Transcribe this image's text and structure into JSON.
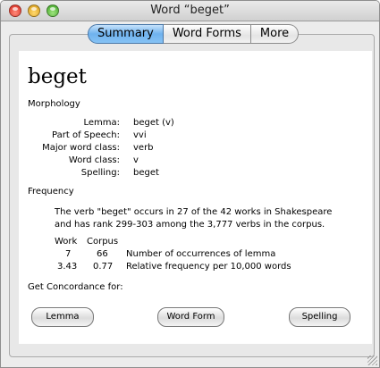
{
  "window": {
    "title": "Word “beget”"
  },
  "tabs": [
    {
      "label": "Summary",
      "selected": true
    },
    {
      "label": "Word Forms",
      "selected": false
    },
    {
      "label": "More",
      "selected": false
    }
  ],
  "summary": {
    "word": "beget",
    "morphology_heading": "Morphology",
    "morphology": [
      {
        "label": "Lemma:",
        "value": "beget (v)"
      },
      {
        "label": "Part of Speech:",
        "value": "vvi"
      },
      {
        "label": "Major word class:",
        "value": "verb"
      },
      {
        "label": "Word class:",
        "value": "v"
      },
      {
        "label": "Spelling:",
        "value": "beget"
      }
    ],
    "frequency_heading": "Frequency",
    "frequency_text": "The verb \"beget\" occurs in 27 of the 42  works in Shakespeare and has rank 299-303 among the 3,777 verbs in the corpus.",
    "table": {
      "headers": [
        "Work",
        "Corpus"
      ],
      "rows": [
        {
          "work": "7",
          "corpus": "66",
          "desc": "Number of occurrences of lemma"
        },
        {
          "work": "3.43",
          "corpus": "0.77",
          "desc": "Relative frequency per 10,000 words"
        }
      ]
    },
    "concordance_label": "Get Concordance for:",
    "buttons": {
      "lemma": "Lemma",
      "word_form": "Word Form",
      "spelling": "Spelling"
    }
  }
}
